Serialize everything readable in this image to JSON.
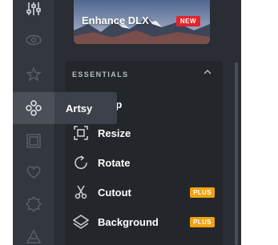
{
  "tooltip": {
    "label": "Artsy"
  },
  "banner": {
    "title": "Enhance DLX",
    "badge": "NEW"
  },
  "section": {
    "title": "ESSENTIALS"
  },
  "tools": [
    {
      "label": "Crop",
      "icon": "crop-icon"
    },
    {
      "label": "Resize",
      "icon": "resize-icon"
    },
    {
      "label": "Rotate",
      "icon": "rotate-icon"
    },
    {
      "label": "Cutout",
      "icon": "scissors-icon",
      "badge": "PLUS"
    },
    {
      "label": "Background",
      "icon": "background-icon",
      "badge": "PLUS"
    }
  ],
  "rail": [
    "adjust-icon",
    "eye-icon",
    "star-icon",
    "artsy-icon",
    "frame-icon",
    "heart-icon",
    "badge-icon",
    "triangle-icon"
  ],
  "colors": {
    "plus_badge": "#f0a20f",
    "new_badge": "#e3242b",
    "panel_bg": "#2a2d33",
    "rail_bg": "#33373e"
  }
}
